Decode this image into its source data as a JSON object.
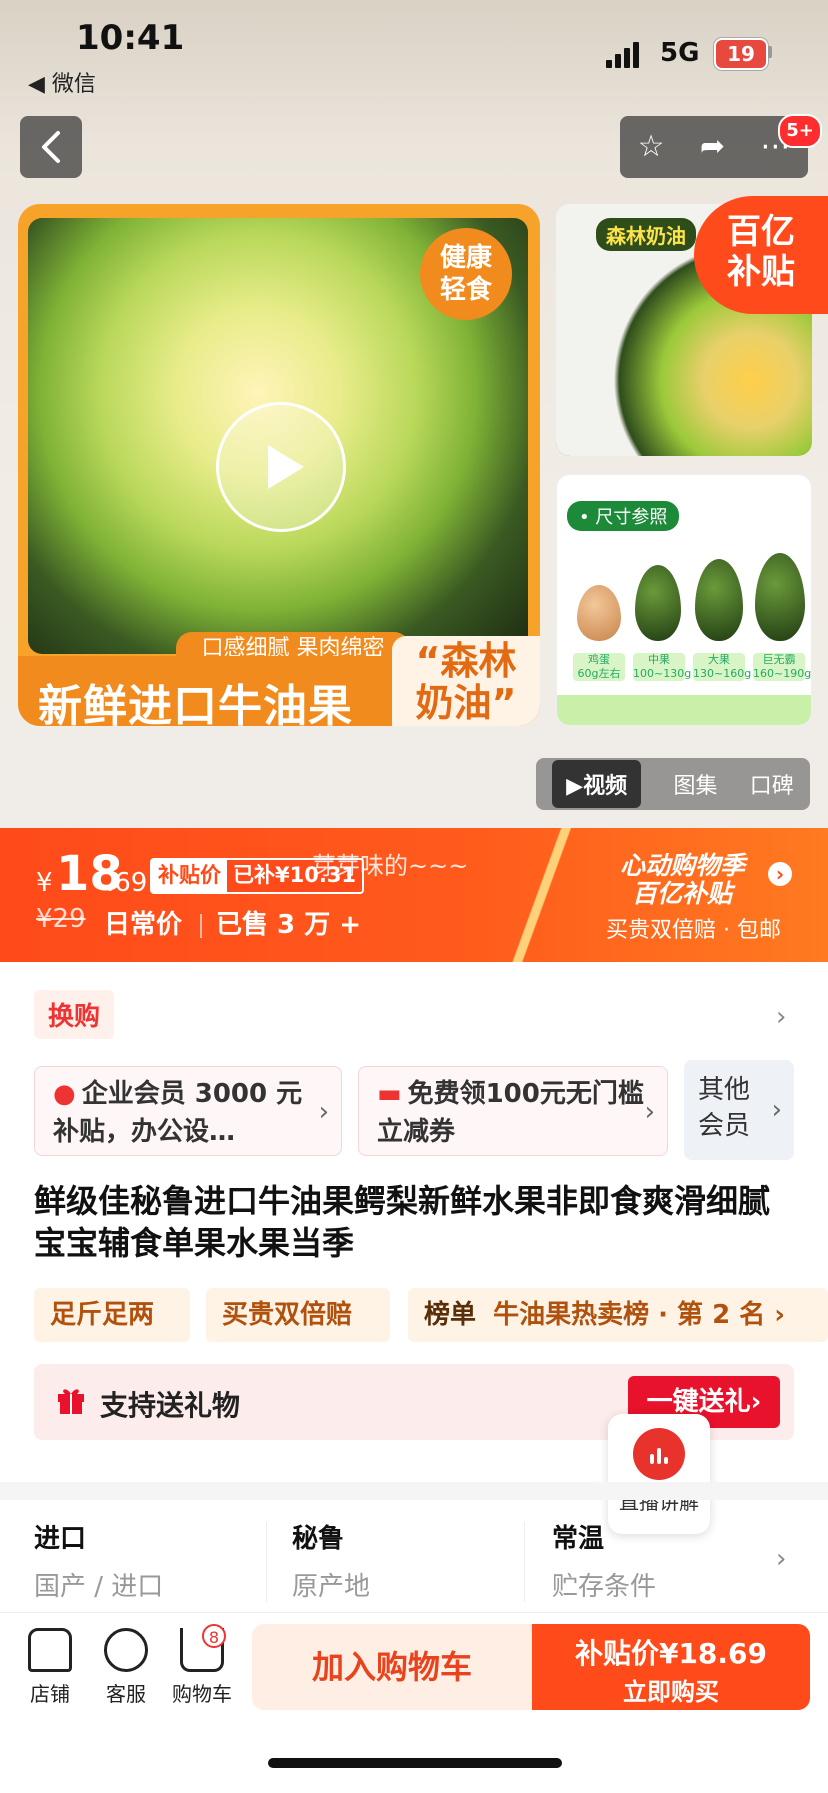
{
  "status_bar": {
    "time": "10:41",
    "back_app": "◀ 微信",
    "network": "5G",
    "battery": "19"
  },
  "header": {
    "back_icon": "chevron-left-icon",
    "actions": [
      "star-icon",
      "share-icon",
      "more-icon"
    ],
    "badge": "5+"
  },
  "main_image": {
    "health_tag": "健康轻食",
    "subtitle_strip": "口感细腻 果肉绵密",
    "caption": "新鲜进口牛油果",
    "quote": "“森林奶油”"
  },
  "thumbnails": {
    "first_tag": "森林奶油",
    "baiyi_line1": "百亿",
    "baiyi_line2": "补贴",
    "size_tag": "• 尺寸参照",
    "size_labels": [
      "鸡蛋\n60g左右",
      "中果\n100~130g",
      "大果\n130~160g",
      "巨无霸\n160~190g"
    ]
  },
  "media_tabs": [
    {
      "label": "▶视频",
      "active": true
    },
    {
      "label": "图集",
      "active": false
    },
    {
      "label": "口碑",
      "active": false
    }
  ],
  "price": {
    "currency": "¥",
    "integer": "18",
    "decimal": ".69",
    "subsidy_label": "补贴价",
    "subsidy_amount": "已补¥10.31",
    "ghost_text": "芽芽味的~~~",
    "old_price": "¥29",
    "daily_label": "日常价",
    "sold": "已售 3 万 +",
    "festival_line1": "心动购物季",
    "festival_line2": "百亿补贴",
    "festival_sub": "买贵双倍赔 · 包邮"
  },
  "swap": {
    "label": "换购"
  },
  "member_cards": [
    {
      "icon": "person-icon",
      "text": "企业会员 3000 元补贴，办公设…"
    },
    {
      "icon": "card-icon",
      "text": "免费领100元无门槛立减券"
    }
  ],
  "other_member": "其他会员",
  "product_title": "鲜级佳秘鲁进口牛油果鳄梨新鲜水果非即食爽滑细腻宝宝辅食单果水果当季",
  "pills": [
    {
      "label": "足斤足两"
    },
    {
      "label": "买贵双倍赔"
    },
    {
      "label_bold": "榜单",
      "label": "牛油果热卖榜 · 第 2 名 ›"
    }
  ],
  "gift": {
    "label": "支持送礼物",
    "button": "一键送礼›"
  },
  "live": {
    "label": "直播讲解"
  },
  "specs": [
    {
      "value": "进口",
      "name": "国产 / 进口"
    },
    {
      "value": "秘鲁",
      "name": "原产地"
    },
    {
      "value": "常温",
      "name": "贮存条件"
    }
  ],
  "bottom_nav": [
    {
      "icon": "store-icon",
      "label": "店铺"
    },
    {
      "icon": "service-icon",
      "label": "客服"
    },
    {
      "icon": "cart-icon",
      "label": "购物车"
    }
  ],
  "cart_count": "8",
  "add_to_cart": "加入购物车",
  "buy": {
    "line1": "补贴价¥18.69",
    "line2": "立即购买"
  },
  "colors": {
    "accent": "#ff4a1a",
    "brand_red": "#e8122c"
  }
}
